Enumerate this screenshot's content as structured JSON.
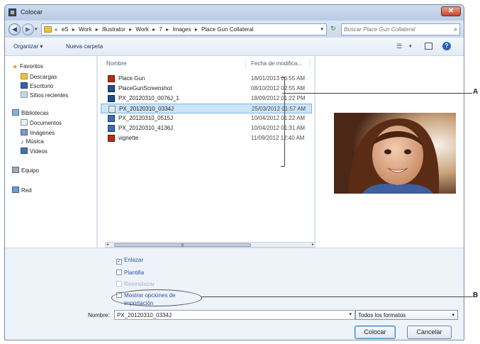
{
  "window": {
    "title": "Colocar",
    "close_glyph": "✕"
  },
  "nav": {
    "back_glyph": "◀",
    "forward_glyph": "▶",
    "dropdown_glyph": "▾",
    "refresh_glyph": "↻"
  },
  "address": {
    "segments": [
      "«",
      "eS",
      "Work",
      "Illustrator",
      "Work",
      "7",
      "Images",
      "Place Gun Collateral"
    ],
    "separator": "▸",
    "dropdown_glyph": "▾"
  },
  "search": {
    "placeholder": "Buscar Place Gun Collateral",
    "icon": "⌕"
  },
  "toolbar": {
    "organize_label": "Organizar ▾",
    "new_folder_label": "Nueva carpeta",
    "view_glyph": "☰",
    "view_dropdown_glyph": "▾",
    "help_glyph": "?"
  },
  "sidebar": {
    "items": [
      {
        "label": "Favoritos",
        "icon": "star-icon"
      },
      {
        "label": "Descargas",
        "icon": "downloads-icon"
      },
      {
        "label": "Escritorio",
        "icon": "desktop-icon"
      },
      {
        "label": "Sitios recientes",
        "icon": "recent-places-icon"
      },
      {
        "label": "Bibliotecas",
        "icon": "libraries-icon"
      },
      {
        "label": "Documentos",
        "icon": "documents-icon"
      },
      {
        "label": "Imágenes",
        "icon": "pictures-icon"
      },
      {
        "label": "Música",
        "icon": "music-icon"
      },
      {
        "label": "Vídeos",
        "icon": "videos-icon"
      },
      {
        "label": "Equipo",
        "icon": "computer-icon"
      },
      {
        "label": "Red",
        "icon": "network-icon"
      }
    ],
    "star_glyph": "★",
    "music_glyph": "♪"
  },
  "files": {
    "columns": {
      "name": "Nombre",
      "date": "Fecha de modifica..."
    },
    "rows": [
      {
        "name": "Place Gun",
        "date": "18/01/2013 06:55 AM",
        "type": "ai"
      },
      {
        "name": "PlaceGunScreenshot",
        "date": "08/10/2012 02:55 AM",
        "type": "psd"
      },
      {
        "name": "PX_20120310_0076J_1",
        "date": "18/09/2012 01:22 PM",
        "type": "psd"
      },
      {
        "name": "PX_20120310_0334J",
        "date": "25/03/2012 01:57 AM",
        "type": "jpg",
        "selected": true
      },
      {
        "name": "PX_20120310_0515J",
        "date": "10/04/2012 01:22 AM",
        "type": "tif"
      },
      {
        "name": "PX_20120310_4136J",
        "date": "10/04/2012 01:31 AM",
        "type": "tif"
      },
      {
        "name": "vignette",
        "date": "11/09/2012 12:40 AM",
        "type": "ai"
      }
    ],
    "scroll_left": "◂",
    "scroll_right": "▸",
    "scroll_grip": "|||"
  },
  "options": {
    "link_label": "Enlazar",
    "template_label": "Plantilla",
    "replace_label": "Reemplazar",
    "show_import_label_1": "Mostrar opciones de",
    "show_import_label_2": "importación",
    "check_glyph": "✓"
  },
  "bottom": {
    "name_label": "Nombre:",
    "name_value": "PX_20120310_0334J",
    "name_dropdown_glyph": "▾",
    "format_value": "Todos los formatos",
    "format_dropdown_glyph": "▾",
    "place_label": "Colocar",
    "cancel_label": "Cancelar"
  },
  "callouts": {
    "a": "A",
    "b": "B"
  },
  "colors": {
    "accent": "#2a55a0",
    "selection": "#cce4f7",
    "window_chrome": "#dbe6f4",
    "close_button": "#c4432c"
  }
}
